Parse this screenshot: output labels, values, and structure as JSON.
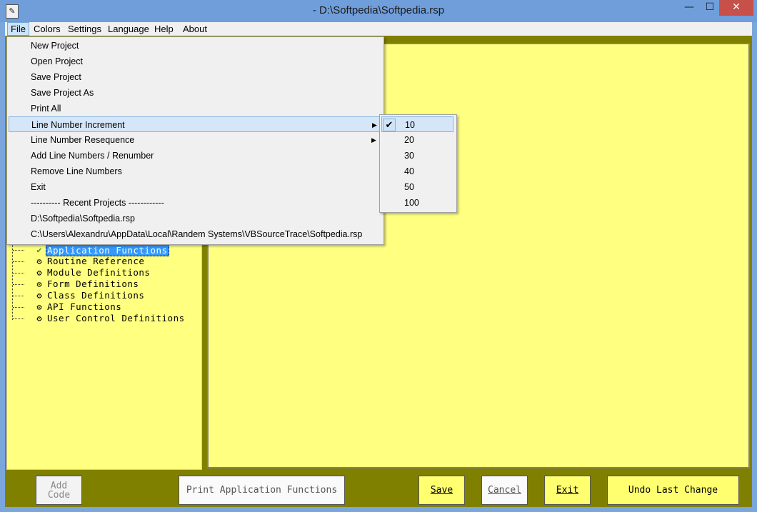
{
  "window": {
    "title": "- D:\\Softpedia\\Softpedia.rsp",
    "minimize": "—",
    "maximize": "☐",
    "close": "✕"
  },
  "menubar": {
    "items": [
      "File",
      "Colors",
      "Settings",
      "Language",
      "Help",
      "About"
    ]
  },
  "file_menu": {
    "items": [
      "New Project",
      "Open Project",
      "Save Project",
      "Save Project As",
      "Print All",
      "Line Number Increment",
      "Line Number Resequence",
      "Add Line Numbers / Renumber",
      "Remove Line Numbers",
      "Exit",
      "---------- Recent Projects ------------",
      "D:\\Softpedia\\Softpedia.rsp",
      "C:\\Users\\Alexandru\\AppData\\Local\\Randem Systems\\VBSourceTrace\\Softpedia.rsp"
    ],
    "highlighted": "Line Number Increment"
  },
  "increment_submenu": {
    "items": [
      "10",
      "20",
      "30",
      "40",
      "50",
      "100"
    ],
    "checked": "10"
  },
  "tree": {
    "items": [
      "Application Functions",
      "Routine Reference",
      "Module Definitions",
      "Form Definitions",
      "Class Definitions",
      "API Functions",
      "User Control Definitions"
    ],
    "selected": "Application Functions"
  },
  "buttons": {
    "add_code_line1": "Add",
    "add_code_line2": "Code",
    "print": "Print Application Functions",
    "save": "Save",
    "cancel": "Cancel",
    "exit": "Exit",
    "undo": "Undo Last Change"
  },
  "icons": {
    "app": "app-icon",
    "check": "checkmark-icon",
    "tree_item": "component-icon",
    "submenu_arrow": "chevron-right-icon"
  },
  "colors": {
    "panel": "#ffff80",
    "frame": "#808000",
    "button_yellow": "#ffff70",
    "selection": "#3399ff"
  }
}
